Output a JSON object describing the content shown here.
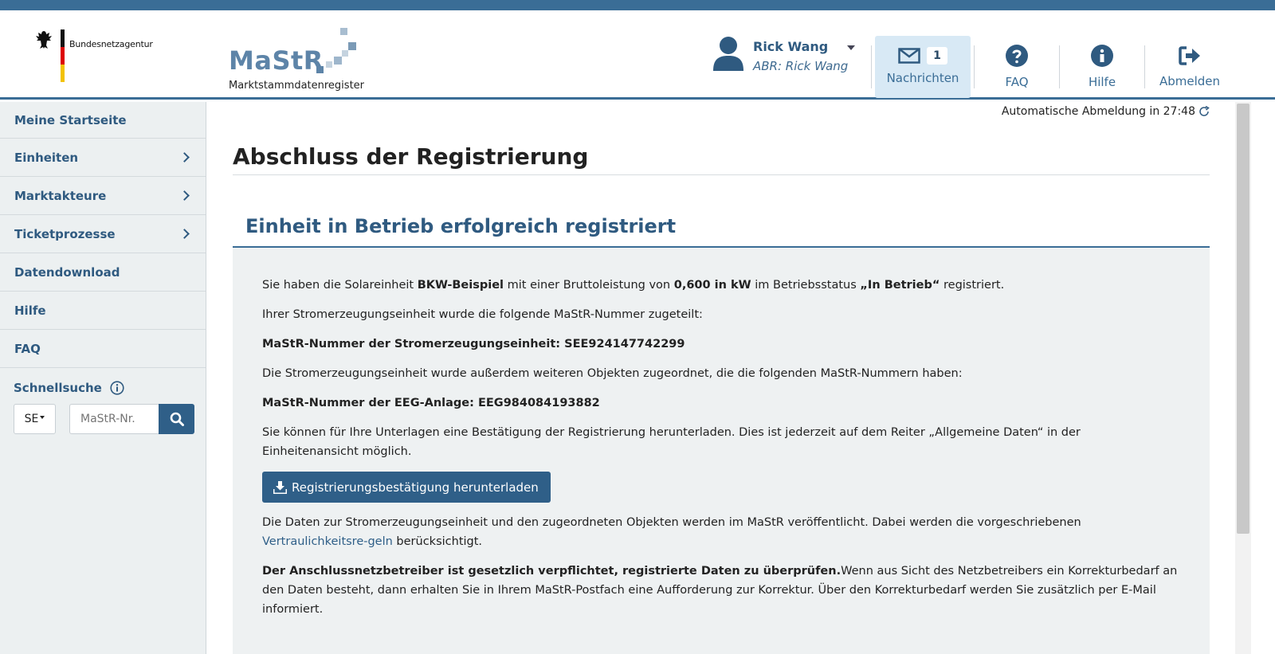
{
  "header": {
    "agency_name": "Bundesnetzagentur",
    "logo_word": "MaStR",
    "logo_subtitle": "Marktstammdatenregister",
    "user_name": "Rick Wang",
    "user_abr": "ABR: Rick Wang",
    "messages_label": "Nachrichten",
    "messages_count": "1",
    "faq_label": "FAQ",
    "help_label": "Hilfe",
    "logout_label": "Abmelden"
  },
  "sidebar": {
    "items": [
      {
        "label": "Meine Startseite",
        "has_chevron": false
      },
      {
        "label": "Einheiten",
        "has_chevron": true
      },
      {
        "label": "Marktakteure",
        "has_chevron": true
      },
      {
        "label": "Ticketprozesse",
        "has_chevron": true
      },
      {
        "label": "Datendownload",
        "has_chevron": false
      },
      {
        "label": "Hilfe",
        "has_chevron": false
      },
      {
        "label": "FAQ",
        "has_chevron": false
      }
    ],
    "quicksearch": {
      "title": "Schnellsuche",
      "select_value": "SE",
      "input_placeholder": "MaStR-Nr."
    }
  },
  "main": {
    "auto_logout": "Automatische Abmeldung in 27:48",
    "page_title": "Abschluss der Registrierung",
    "section_title": "Einheit in Betrieb erfolgreich registriert",
    "p1": {
      "t1": "Sie haben die Solareinheit ",
      "b1": "BKW-Beispiel",
      "t2": " mit einer Bruttoleistung von ",
      "b2": "0,600 in kW",
      "t3": " im Betriebsstatus ",
      "b3": "„In Betrieb“",
      "t4": " registriert."
    },
    "p2": "Ihrer Stromerzeugungseinheit wurde die folgende MaStR-Nummer zugeteilt:",
    "p3": "MaStR-Nummer der Stromerzeugungseinheit: SEE924147742299",
    "p4": "Die Stromerzeugungseinheit wurde außerdem weiteren Objekten zugeordnet, die die folgenden MaStR-Nummern haben:",
    "p5": "MaStR-Nummer der EEG-Anlage: EEG984084193882",
    "p6": "Sie können für Ihre Unterlagen eine Bestätigung der Registrierung herunterladen. Dies ist jederzeit auf dem Reiter „Allgemeine Daten“ in der Einheitenansicht möglich.",
    "download_label": "Registrierungsbestätigung herunterladen",
    "p7": {
      "t1": "Die Daten zur Stromerzeugungseinheit und den zugeordneten Objekten werden im MaStR veröffentlicht. Dabei werden die vorgeschriebenen ",
      "link": "Vertraulichkeitsre-geln",
      "t2": " berücksichtigt."
    },
    "p8": {
      "b1": "Der Anschlussnetzbetreiber ist gesetzlich verpflichtet, registrierte Daten zu überprüfen.",
      "t1": "Wenn aus Sicht des Netzbetreibers ein Korrekturbedarf an den Daten besteht, dann erhalten Sie in Ihrem MaStR-Postfach eine Aufforderung zur Korrektur. Über den Korrekturbedarf werden Sie zusätzlich per E-Mail informiert."
    }
  },
  "colors": {
    "brand_blue": "#3a6d96",
    "link_blue": "#2f5f88",
    "sidebar_bg": "#ecf0f1",
    "panel_bg": "#eef1f2",
    "messages_bg": "#d8e9f5"
  },
  "icons": {
    "agency": "federal-eagle-icon",
    "user": "user-icon",
    "messages": "envelope-icon",
    "faq": "question-circle-icon",
    "help": "info-circle-icon",
    "logout": "sign-out-icon",
    "quicksearch_info": "info-outline-icon",
    "search": "search-icon",
    "refresh": "refresh-icon",
    "download": "download-icon"
  }
}
